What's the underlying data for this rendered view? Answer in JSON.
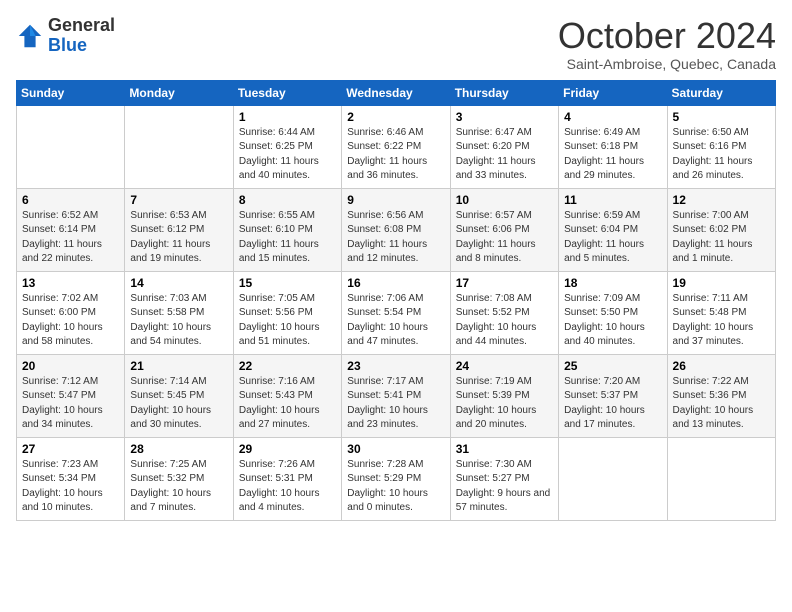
{
  "header": {
    "logo": {
      "line1": "General",
      "line2": "Blue"
    },
    "title": "October 2024",
    "subtitle": "Saint-Ambroise, Quebec, Canada"
  },
  "calendar": {
    "days_of_week": [
      "Sunday",
      "Monday",
      "Tuesday",
      "Wednesday",
      "Thursday",
      "Friday",
      "Saturday"
    ],
    "weeks": [
      [
        {
          "day": "",
          "info": ""
        },
        {
          "day": "",
          "info": ""
        },
        {
          "day": "1",
          "info": "Sunrise: 6:44 AM\nSunset: 6:25 PM\nDaylight: 11 hours and 40 minutes."
        },
        {
          "day": "2",
          "info": "Sunrise: 6:46 AM\nSunset: 6:22 PM\nDaylight: 11 hours and 36 minutes."
        },
        {
          "day": "3",
          "info": "Sunrise: 6:47 AM\nSunset: 6:20 PM\nDaylight: 11 hours and 33 minutes."
        },
        {
          "day": "4",
          "info": "Sunrise: 6:49 AM\nSunset: 6:18 PM\nDaylight: 11 hours and 29 minutes."
        },
        {
          "day": "5",
          "info": "Sunrise: 6:50 AM\nSunset: 6:16 PM\nDaylight: 11 hours and 26 minutes."
        }
      ],
      [
        {
          "day": "6",
          "info": "Sunrise: 6:52 AM\nSunset: 6:14 PM\nDaylight: 11 hours and 22 minutes."
        },
        {
          "day": "7",
          "info": "Sunrise: 6:53 AM\nSunset: 6:12 PM\nDaylight: 11 hours and 19 minutes."
        },
        {
          "day": "8",
          "info": "Sunrise: 6:55 AM\nSunset: 6:10 PM\nDaylight: 11 hours and 15 minutes."
        },
        {
          "day": "9",
          "info": "Sunrise: 6:56 AM\nSunset: 6:08 PM\nDaylight: 11 hours and 12 minutes."
        },
        {
          "day": "10",
          "info": "Sunrise: 6:57 AM\nSunset: 6:06 PM\nDaylight: 11 hours and 8 minutes."
        },
        {
          "day": "11",
          "info": "Sunrise: 6:59 AM\nSunset: 6:04 PM\nDaylight: 11 hours and 5 minutes."
        },
        {
          "day": "12",
          "info": "Sunrise: 7:00 AM\nSunset: 6:02 PM\nDaylight: 11 hours and 1 minute."
        }
      ],
      [
        {
          "day": "13",
          "info": "Sunrise: 7:02 AM\nSunset: 6:00 PM\nDaylight: 10 hours and 58 minutes."
        },
        {
          "day": "14",
          "info": "Sunrise: 7:03 AM\nSunset: 5:58 PM\nDaylight: 10 hours and 54 minutes."
        },
        {
          "day": "15",
          "info": "Sunrise: 7:05 AM\nSunset: 5:56 PM\nDaylight: 10 hours and 51 minutes."
        },
        {
          "day": "16",
          "info": "Sunrise: 7:06 AM\nSunset: 5:54 PM\nDaylight: 10 hours and 47 minutes."
        },
        {
          "day": "17",
          "info": "Sunrise: 7:08 AM\nSunset: 5:52 PM\nDaylight: 10 hours and 44 minutes."
        },
        {
          "day": "18",
          "info": "Sunrise: 7:09 AM\nSunset: 5:50 PM\nDaylight: 10 hours and 40 minutes."
        },
        {
          "day": "19",
          "info": "Sunrise: 7:11 AM\nSunset: 5:48 PM\nDaylight: 10 hours and 37 minutes."
        }
      ],
      [
        {
          "day": "20",
          "info": "Sunrise: 7:12 AM\nSunset: 5:47 PM\nDaylight: 10 hours and 34 minutes."
        },
        {
          "day": "21",
          "info": "Sunrise: 7:14 AM\nSunset: 5:45 PM\nDaylight: 10 hours and 30 minutes."
        },
        {
          "day": "22",
          "info": "Sunrise: 7:16 AM\nSunset: 5:43 PM\nDaylight: 10 hours and 27 minutes."
        },
        {
          "day": "23",
          "info": "Sunrise: 7:17 AM\nSunset: 5:41 PM\nDaylight: 10 hours and 23 minutes."
        },
        {
          "day": "24",
          "info": "Sunrise: 7:19 AM\nSunset: 5:39 PM\nDaylight: 10 hours and 20 minutes."
        },
        {
          "day": "25",
          "info": "Sunrise: 7:20 AM\nSunset: 5:37 PM\nDaylight: 10 hours and 17 minutes."
        },
        {
          "day": "26",
          "info": "Sunrise: 7:22 AM\nSunset: 5:36 PM\nDaylight: 10 hours and 13 minutes."
        }
      ],
      [
        {
          "day": "27",
          "info": "Sunrise: 7:23 AM\nSunset: 5:34 PM\nDaylight: 10 hours and 10 minutes."
        },
        {
          "day": "28",
          "info": "Sunrise: 7:25 AM\nSunset: 5:32 PM\nDaylight: 10 hours and 7 minutes."
        },
        {
          "day": "29",
          "info": "Sunrise: 7:26 AM\nSunset: 5:31 PM\nDaylight: 10 hours and 4 minutes."
        },
        {
          "day": "30",
          "info": "Sunrise: 7:28 AM\nSunset: 5:29 PM\nDaylight: 10 hours and 0 minutes."
        },
        {
          "day": "31",
          "info": "Sunrise: 7:30 AM\nSunset: 5:27 PM\nDaylight: 9 hours and 57 minutes."
        },
        {
          "day": "",
          "info": ""
        },
        {
          "day": "",
          "info": ""
        }
      ]
    ]
  }
}
